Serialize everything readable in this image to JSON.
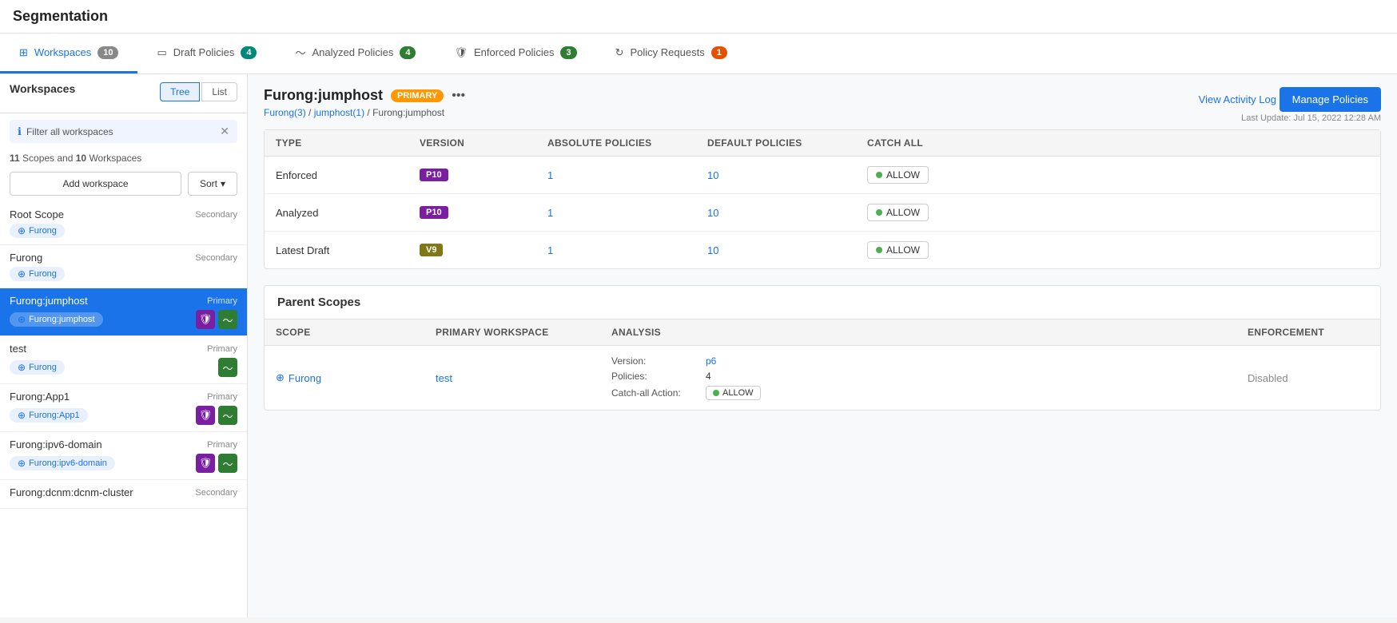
{
  "app": {
    "title": "Segmentation"
  },
  "tabs": [
    {
      "id": "workspaces",
      "label": "Workspaces",
      "badge": "10",
      "badgeClass": "badge-gray",
      "active": true,
      "icon": "workspace-icon"
    },
    {
      "id": "draft",
      "label": "Draft Policies",
      "badge": "4",
      "badgeClass": "badge-teal",
      "active": false,
      "icon": "draft-icon"
    },
    {
      "id": "analyzed",
      "label": "Analyzed Policies",
      "badge": "4",
      "badgeClass": "badge-green",
      "active": false,
      "icon": "analyzed-icon"
    },
    {
      "id": "enforced",
      "label": "Enforced Policies",
      "badge": "3",
      "badgeClass": "badge-green",
      "active": false,
      "icon": "enforced-icon"
    },
    {
      "id": "requests",
      "label": "Policy Requests",
      "badge": "1",
      "badgeClass": "badge-orange",
      "active": false,
      "icon": "requests-icon"
    }
  ],
  "sidebar": {
    "title": "Workspaces",
    "viewToggle": {
      "tree": "Tree",
      "list": "List",
      "active": "Tree"
    },
    "filter": {
      "text": "Filter all workspaces"
    },
    "scopeCount": {
      "scopes": "11",
      "workspaces": "10"
    },
    "addWorkspaceLabel": "Add workspace",
    "sortLabel": "Sort",
    "items": [
      {
        "id": "root-scope",
        "name": "Root Scope",
        "type": "Secondary",
        "scope": "Furong",
        "icons": []
      },
      {
        "id": "furong",
        "name": "Furong",
        "type": "Secondary",
        "scope": "Furong",
        "icons": []
      },
      {
        "id": "furong-jumphost",
        "name": "Furong:jumphost",
        "type": "Primary",
        "scope": "Furong:jumphost",
        "icons": [
          "shield",
          "wave"
        ],
        "selected": true
      },
      {
        "id": "test",
        "name": "test",
        "type": "Primary",
        "scope": "Furong",
        "icons": [
          "wave"
        ]
      },
      {
        "id": "furong-app1",
        "name": "Furong:App1",
        "type": "Primary",
        "scope": "Furong:App1",
        "icons": [
          "shield",
          "wave"
        ]
      },
      {
        "id": "furong-ipv6",
        "name": "Furong:ipv6-domain",
        "type": "Primary",
        "scope": "Furong:ipv6-domain",
        "icons": [
          "shield",
          "wave"
        ]
      },
      {
        "id": "furong-dcnm",
        "name": "Furong:dcnm:dcnm-cluster",
        "type": "Secondary",
        "scope": "",
        "icons": []
      }
    ]
  },
  "panel": {
    "title": "Furong:jumphost",
    "primaryBadge": "PRIMARY",
    "breadcrumb": {
      "parts": [
        "Furong(3)",
        "jumphost(1)",
        "Furong:jumphost"
      ],
      "links": [
        0,
        1
      ]
    },
    "lastUpdate": "Last Update: Jul 15, 2022 12:28 AM",
    "viewActivityLog": "View Activity Log",
    "managePolicies": "Manage Policies",
    "policiesTable": {
      "headers": [
        "Type",
        "Version",
        "Absolute Policies",
        "Default Policies",
        "Catch All"
      ],
      "rows": [
        {
          "type": "Enforced",
          "version": "P10",
          "versionClass": "version-purple",
          "absolute": "1",
          "default": "10",
          "catchAll": "ALLOW"
        },
        {
          "type": "Analyzed",
          "version": "P10",
          "versionClass": "version-purple",
          "absolute": "1",
          "default": "10",
          "catchAll": "ALLOW"
        },
        {
          "type": "Latest Draft",
          "version": "V9",
          "versionClass": "version-olive",
          "absolute": "1",
          "default": "10",
          "catchAll": "ALLOW"
        }
      ]
    },
    "parentScopes": {
      "title": "Parent Scopes",
      "headers": [
        "Scope",
        "Primary Workspace",
        "Analysis",
        "Enforcement"
      ],
      "rows": [
        {
          "scope": "Furong",
          "primaryWorkspace": "test",
          "analysis": {
            "version": "p6",
            "policies": "4",
            "catchAllAction": "ALLOW"
          },
          "enforcement": "Disabled"
        }
      ]
    }
  }
}
